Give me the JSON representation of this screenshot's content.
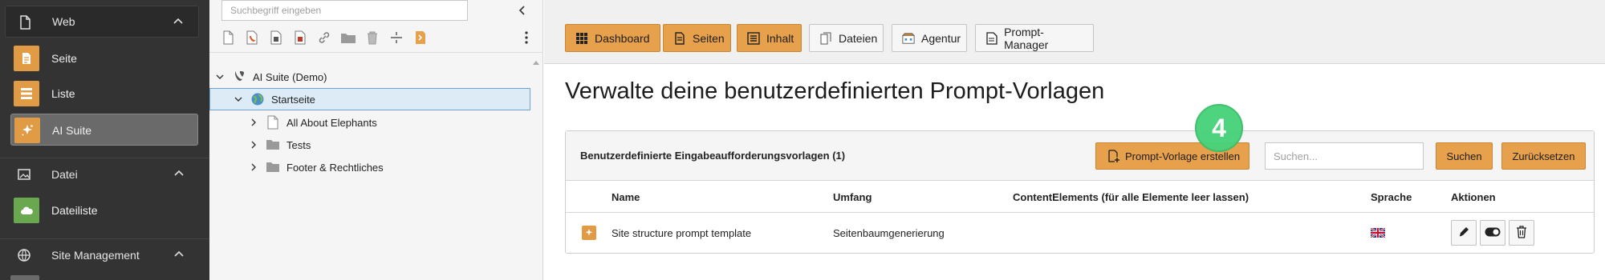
{
  "module_menu": {
    "groups": [
      {
        "label": "Web",
        "icon": "page-icon",
        "expanded": true
      },
      {
        "label": "Datei",
        "icon": "image-icon",
        "expanded": true
      },
      {
        "label": "Site Management",
        "icon": "globe-icon",
        "expanded": true
      }
    ],
    "items": [
      {
        "label": "Seite",
        "icon": "page-module-icon",
        "color": "#e29b45"
      },
      {
        "label": "Liste",
        "icon": "list-module-icon",
        "color": "#e29b45"
      },
      {
        "label": "AI Suite",
        "icon": "sparkle-icon",
        "color": "#e29b45",
        "active": true
      },
      {
        "label": "Dateiliste",
        "icon": "cloud-file-icon",
        "color": "#6aa84f"
      }
    ]
  },
  "page_tree": {
    "search_placeholder": "Suchbegriff eingeben",
    "root": {
      "label": "AI Suite (Demo)",
      "icon": "typo3-logo-icon"
    },
    "nodes": [
      {
        "label": "Startseite",
        "icon": "globe-page-icon",
        "selected": true
      },
      {
        "label": "All About Elephants",
        "icon": "page-icon"
      },
      {
        "label": "Tests",
        "icon": "folder-icon"
      },
      {
        "label": "Footer & Rechtliches",
        "icon": "folder-icon"
      }
    ]
  },
  "nav_buttons": [
    {
      "label": "Dashboard",
      "icon": "grid-icon",
      "style": "orange"
    },
    {
      "label": "Seiten",
      "icon": "pages-icon",
      "style": "orange"
    },
    {
      "label": "Inhalt",
      "icon": "content-icon",
      "style": "orange"
    },
    {
      "label": "Dateien",
      "icon": "files-icon",
      "style": "grey"
    },
    {
      "label": "Agentur",
      "icon": "agency-icon",
      "style": "grey"
    },
    {
      "label": "Prompt-Manager",
      "icon": "document-icon",
      "style": "grey"
    }
  ],
  "main": {
    "title": "Verwalte deine benutzerdefinierten Prompt-Vorlagen",
    "panel": {
      "title": "Benutzerdefinierte Eingabeaufforderungsvorlagen (1)",
      "create_label": "Prompt-Vorlage erstellen",
      "search_placeholder": "Suchen...",
      "search_label": "Suchen",
      "reset_label": "Zurücksetzen",
      "columns": [
        "Name",
        "Umfang",
        "ContentElements (für alle Elemente leer lassen)",
        "Sprache",
        "Aktionen"
      ],
      "rows": [
        {
          "name": "Site structure prompt template",
          "scope": "Seitenbaumgenerierung",
          "content_elements": "",
          "language_flag": "uk-flag-icon"
        }
      ]
    }
  },
  "step_badge": "4",
  "colors": {
    "accent": "#e7a04b",
    "sidebar_bg": "#333333",
    "badge": "#47d27a"
  }
}
